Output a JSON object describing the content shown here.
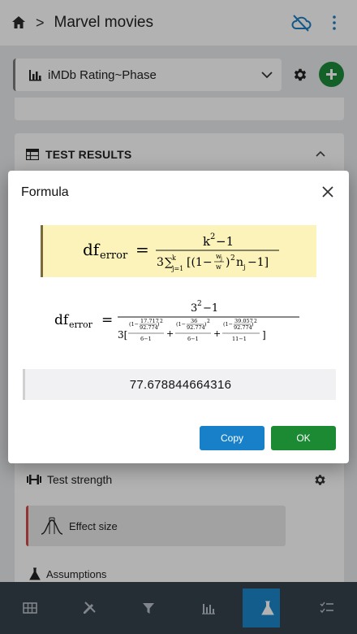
{
  "app": {
    "title": "Marvel movies"
  },
  "analysis_select": {
    "value": "iMDb Rating~Phase"
  },
  "results": {
    "header": "TEST RESULTS"
  },
  "test_strength": {
    "label": "Test strength"
  },
  "effect_size": {
    "label": "Effect size"
  },
  "assumptions": {
    "label": "Assumptions"
  },
  "dialog": {
    "title": "Formula",
    "formula_general": {
      "lhs_base": "df",
      "lhs_sub": "error",
      "num_base": "k",
      "num_exp": "2",
      "num_tail": "−1",
      "den_lead": "3",
      "den_sum": "∑",
      "den_sum_upper": "k",
      "den_sum_lower": "j=1",
      "den_open": "[(1−",
      "den_w_num": "w",
      "den_w_num_sub": "j",
      "den_w_den": "w",
      "den_close": ")",
      "den_exp": "2",
      "den_tail_base": "n",
      "den_tail_sub": "j",
      "den_tail_end": "−1]"
    },
    "formula_numeric": {
      "lhs_base": "df",
      "lhs_sub": "error",
      "num_base": "3",
      "num_exp": "2",
      "num_tail": "−1",
      "den_lead": "3[",
      "den_close": "]",
      "terms": [
        {
          "w": "17.717",
          "w_total": "92.774",
          "exp": "2",
          "den": "6−1"
        },
        {
          "w": "36",
          "w_total": "92.774",
          "exp": "2",
          "den": "6−1"
        },
        {
          "w": "39.057",
          "w_total": "92.774",
          "exp": "2",
          "den": "11−1"
        }
      ]
    },
    "result_value": "77.678844664316",
    "copy_label": "Copy",
    "ok_label": "OK"
  },
  "icons": {
    "home": "home-icon",
    "cloud_off": "cloud-off-icon",
    "more": "more-vert-icon",
    "bar_chart": "bar-chart-icon",
    "settings": "gear-icon",
    "add": "plus-icon"
  },
  "colors": {
    "accent_blue": "#1780c8",
    "accent_green": "#1b8a33",
    "nav_bg": "#37424c",
    "nav_active": "#1a86c9",
    "formula_highlight": "#fbf3b9"
  }
}
